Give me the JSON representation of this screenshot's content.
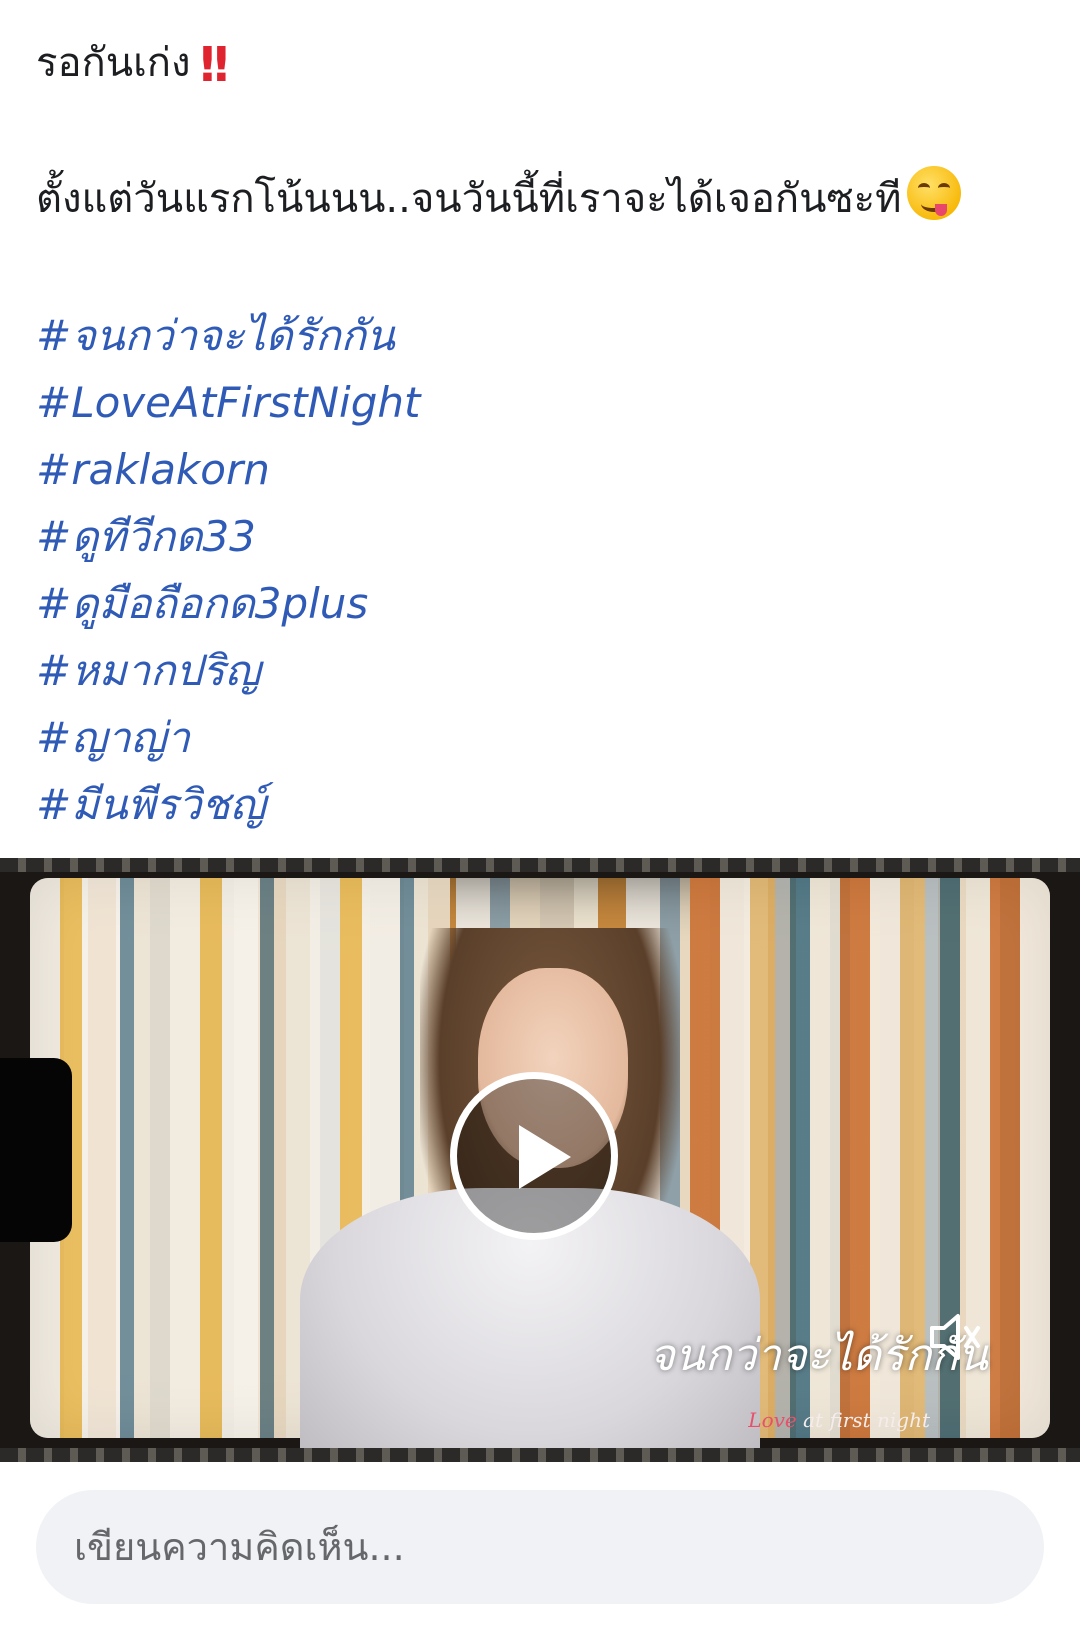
{
  "post": {
    "line1": "รอกันเก่ง",
    "line1_emoji": "‼️",
    "line2": "ตั้งแต่วันแรกโน้นนน..จนวันนี้ที่เราจะได้เจอกันซะที",
    "line2_emoji": "face-savoring-food-emoji",
    "hashtags": [
      "#จนกว่าจะได้รักกัน",
      "#LoveAtFirstNight",
      "#raklakorn",
      "#ดูทีวีกด33",
      "#ดูมือถือกด3plus",
      "#หมากปริญ",
      "#ญาญ่า",
      "#มีนพีรวิชญ์"
    ],
    "hashtag_color": "#2f5bb7"
  },
  "video": {
    "caption": "จนกว่าจะได้รักกัน",
    "subcaption_accent": "Love",
    "subcaption_rest": " at first night",
    "play_icon": "play-icon",
    "mute_icon": "speaker-muted-icon"
  },
  "comment": {
    "placeholder": "เขียนความคิดเห็น..."
  }
}
